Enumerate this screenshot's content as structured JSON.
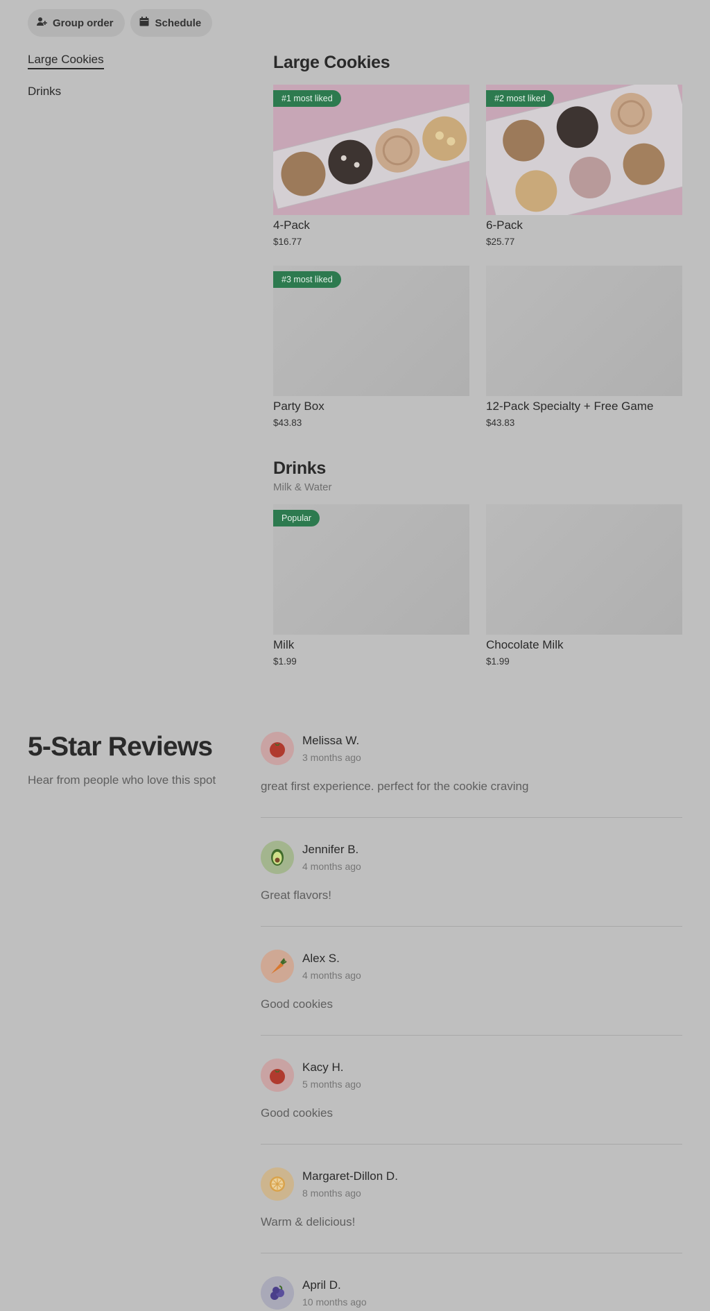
{
  "header": {
    "group_order_label": "Group order",
    "schedule_label": "Schedule"
  },
  "sidenav": {
    "items": [
      {
        "label": "Large Cookies",
        "active": true
      },
      {
        "label": "Drinks",
        "active": false
      }
    ]
  },
  "menu": {
    "large_cookies": {
      "title": "Large Cookies",
      "items": [
        {
          "name": "4-Pack",
          "price": "$16.77",
          "badge": "#1 most liked"
        },
        {
          "name": "6-Pack",
          "price": "$25.77",
          "badge": "#2 most liked"
        },
        {
          "name": "Party Box",
          "price": "$43.83",
          "badge": "#3 most liked"
        },
        {
          "name": "12-Pack Specialty + Free Game",
          "price": "$43.83",
          "badge": ""
        }
      ]
    },
    "drinks": {
      "title": "Drinks",
      "subtitle": "Milk & Water",
      "items": [
        {
          "name": "Milk",
          "price": "$1.99",
          "badge": "Popular"
        },
        {
          "name": "Chocolate Milk",
          "price": "$1.99",
          "badge": ""
        }
      ]
    }
  },
  "reviews": {
    "title": "5-Star Reviews",
    "subtitle": "Hear from people who love this spot",
    "items": [
      {
        "name": "Melissa W.",
        "time": "3 months ago",
        "text": "great first experience. perfect for the cookie craving",
        "avatar": "tomato-icon"
      },
      {
        "name": "Jennifer B.",
        "time": "4 months ago",
        "text": "Great flavors!",
        "avatar": "avocado-icon"
      },
      {
        "name": "Alex S.",
        "time": "4 months ago",
        "text": "Good cookies",
        "avatar": "carrot-icon"
      },
      {
        "name": "Kacy H.",
        "time": "5 months ago",
        "text": "Good cookies",
        "avatar": "tomato-icon"
      },
      {
        "name": "Margaret-Dillon D.",
        "time": "8 months ago",
        "text": "Warm & delicious!",
        "avatar": "orange-slice-icon"
      },
      {
        "name": "April D.",
        "time": "10 months ago",
        "text": "",
        "avatar": "blueberry-icon"
      }
    ]
  },
  "colors": {
    "overlay_bg": "#bfbfbf",
    "badge_green": "#2d7a4f"
  }
}
